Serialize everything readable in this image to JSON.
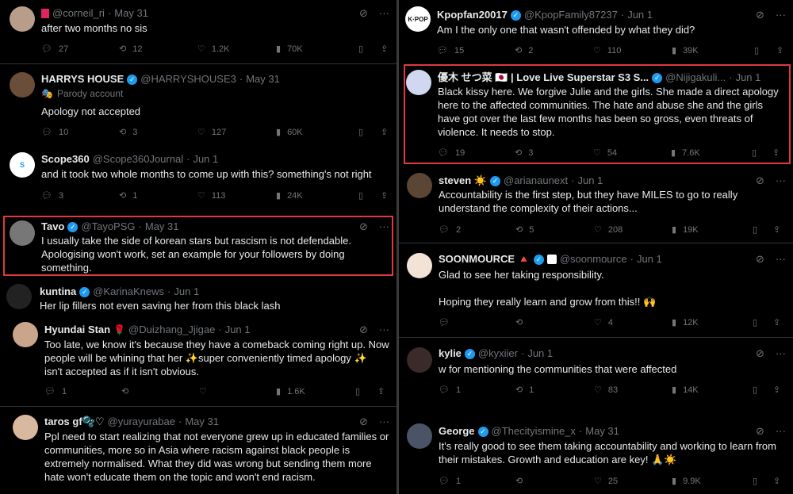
{
  "left": {
    "tweets": [
      {
        "name": "",
        "handle": "@corneil_ri",
        "date": "May 31",
        "text": "after two months no sis",
        "replies": "27",
        "retweets": "12",
        "likes": "1.2K",
        "views": "70K"
      },
      {
        "name": "HARRYS HOUSE",
        "handle": "@HARRYSHOUSE3",
        "date": "May 31",
        "sub": "Parody account",
        "text": "Apology not accepted",
        "replies": "10",
        "retweets": "3",
        "likes": "127",
        "views": "60K"
      },
      {
        "name": "Scope360",
        "handle": "@Scope360Journal",
        "date": "Jun 1",
        "text": "and it took two whole months to come up with this? something's not right",
        "replies": "3",
        "retweets": "1",
        "likes": "113",
        "views": "24K"
      },
      {
        "name": "Tavo",
        "handle": "@TayoPSG",
        "date": "May 31",
        "text": "I usually take the side of korean stars but rascism is not defendable.\nApologising won't work, set an example for your followers by doing\nsomething."
      },
      {
        "name": "kuntina",
        "handle": "@KarinaKnews",
        "date": "Jun 1",
        "text": "Her lip fillers not even saving her from this black lash"
      },
      {
        "name": "Hyundai Stan",
        "handle": "@Duizhang_Jjigae",
        "date": "Jun 1",
        "text": "Too late, we know it's because they have a comeback coming right up. Now\npeople will be whining that her ✨super conveniently timed apology ✨\nisn't accepted as if it isn't obvious.",
        "replies": "1",
        "retweets": "",
        "likes": "",
        "views": "1.6K"
      },
      {
        "name": "taros gf🫧♡",
        "handle": "@yurayurabae",
        "date": "May 31",
        "text": "Ppl need to start realizing that not everyone grew up in educated families or\ncommunities, more so in Asia where racism against black people is\nextremely normalised. What they did was wrong but sending them more\nhate won't educate them on the topic and won't end racism."
      }
    ]
  },
  "right": {
    "tweets": [
      {
        "name": "Kpopfan20017",
        "handle": "@KpopFamily87237",
        "date": "Jun 1",
        "text": "Am I the only one that wasn't offended by what they did?",
        "replies": "15",
        "retweets": "2",
        "likes": "110",
        "views": "39K"
      },
      {
        "name": "優木 せつ菜 🇯🇵 | Love Live Superstar S3 S...",
        "handle": "@Nijigakuli...",
        "date": "Jun 1",
        "text": "Black kissy here. We forgive Julie and the girls. She made a direct apology\nhere to the affected communities. The hate and abuse she and the girls\nhave got over the last few months has been so gross, even threats of\nviolence. It needs to stop.",
        "replies": "19",
        "retweets": "3",
        "likes": "54",
        "views": "7.6K"
      },
      {
        "name": "steven ☀️",
        "handle": "@arianaunext",
        "date": "Jun 1",
        "text": "Accountability is the first step, but they have MILES to go to really\nunderstand the complexity of their actions...",
        "replies": "2",
        "retweets": "5",
        "likes": "208",
        "views": "19K"
      },
      {
        "name": "SOONMOURCE 🔺",
        "handle": "@soonmource",
        "date": "Jun 1",
        "text": "Glad to see her taking responsibility.\n\nHoping they really learn and grow from this!! 🙌",
        "replies": "",
        "retweets": "",
        "likes": "4",
        "views": "12K"
      },
      {
        "name": "kylie",
        "handle": "@kyxiier",
        "date": "Jun 1",
        "text": "w for mentioning the communities that were affected",
        "replies": "1",
        "retweets": "1",
        "likes": "83",
        "views": "14K"
      },
      {
        "name": "George",
        "handle": "@Thecityismine_x",
        "date": "May 31",
        "text": "It's really good to see them taking accountability and working to learn from\ntheir mistakes. Growth and education are key! 🙏☀️",
        "replies": "1",
        "retweets": "",
        "likes": "25",
        "views": "9.9K"
      }
    ]
  },
  "colors": {
    "verified": "#1d9bf0",
    "highlight": "#e0393e",
    "muted": "#71767b"
  }
}
